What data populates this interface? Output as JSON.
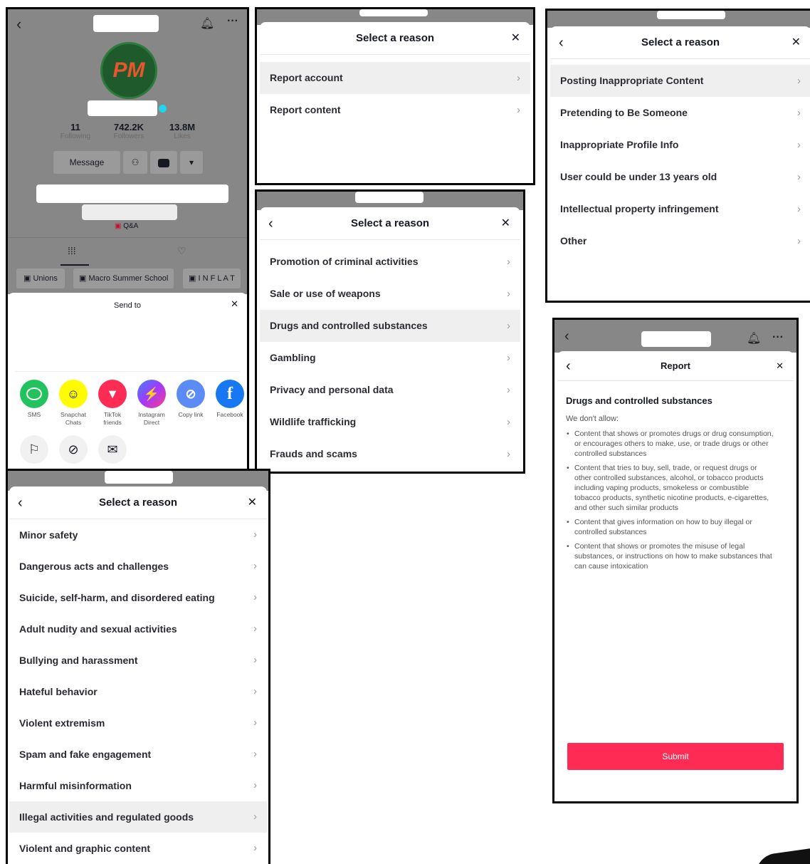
{
  "colors": {
    "submit": "#fe2c55",
    "dim_bg": "#878787",
    "verified": "#20d5ec"
  },
  "profile": {
    "avatar_text": "PM",
    "stats": [
      {
        "value": "11",
        "label": "Following"
      },
      {
        "value": "742.2K",
        "label": "Followers"
      },
      {
        "value": "13.8M",
        "label": "Likes"
      }
    ],
    "message_label": "Message",
    "qa_label": "Q&A",
    "playlists": [
      "Unions",
      "Macro Summer School",
      "I N F L A T"
    ]
  },
  "share_sheet": {
    "title": "Send to",
    "apps": [
      {
        "label": "SMS",
        "icon": "sms-icon",
        "color": "#22c35e"
      },
      {
        "label": "Snapchat Chats",
        "icon": "snapchat-icon",
        "color": "#fffc00"
      },
      {
        "label": "TikTok friends",
        "icon": "send-icon",
        "color": "#fe2c55"
      },
      {
        "label": "Instagram Direct",
        "icon": "messenger-icon",
        "color": "#a239ff"
      },
      {
        "label": "Copy link",
        "icon": "link-icon",
        "color": "#3b82f6"
      },
      {
        "label": "Facebook",
        "icon": "facebook-icon",
        "color": "#1877f2"
      }
    ],
    "actions": [
      {
        "icon": "flag-icon"
      },
      {
        "icon": "block-icon"
      },
      {
        "icon": "mail-icon"
      }
    ]
  },
  "panel_account": {
    "title": "Select a reason",
    "items": [
      "Report account",
      "Report content"
    ]
  },
  "panel_profile_reasons": {
    "title": "Select a reason",
    "items": [
      "Posting Inappropriate Content",
      "Pretending to Be Someone",
      "Inappropriate Profile Info",
      "User could be under 13 years old",
      "Intellectual property infringement",
      "Other"
    ]
  },
  "panel_illegal_reasons": {
    "title": "Select a reason",
    "items": [
      "Promotion of criminal activities",
      "Sale or use of weapons",
      "Drugs and controlled substances",
      "Gambling",
      "Privacy and personal data",
      "Wildlife trafficking",
      "Frauds and scams"
    ]
  },
  "panel_content_reasons": {
    "title": "Select a reason",
    "items": [
      "Minor safety",
      "Dangerous acts and challenges",
      "Suicide, self-harm, and disordered eating",
      "Adult nudity and sexual activities",
      "Bullying and harassment",
      "Hateful behavior",
      "Violent extremism",
      "Spam and fake engagement",
      "Harmful misinformation",
      "Illegal activities and regulated goods",
      "Violent and graphic content"
    ]
  },
  "panel_report": {
    "title": "Report",
    "heading": "Drugs and controlled substances",
    "intro": "We don't allow:",
    "bullets": [
      "Content that shows or promotes drugs or drug consumption, or encourages others to make, use, or trade drugs or other controlled substances",
      "Content that tries to buy, sell, trade, or request drugs or other controlled substances, alcohol, or tobacco products including vaping products, smokeless or combustible tobacco products, synthetic nicotine products, e-cigarettes, and other such similar products",
      "Content that gives information on how to buy illegal or controlled substances",
      "Content that shows or promotes the misuse of legal substances, or instructions on how to make substances that can cause intoxication"
    ],
    "submit_label": "Submit"
  },
  "common": {
    "back_glyph": "‹",
    "close_glyph": "✕",
    "chevron_glyph": "›"
  }
}
